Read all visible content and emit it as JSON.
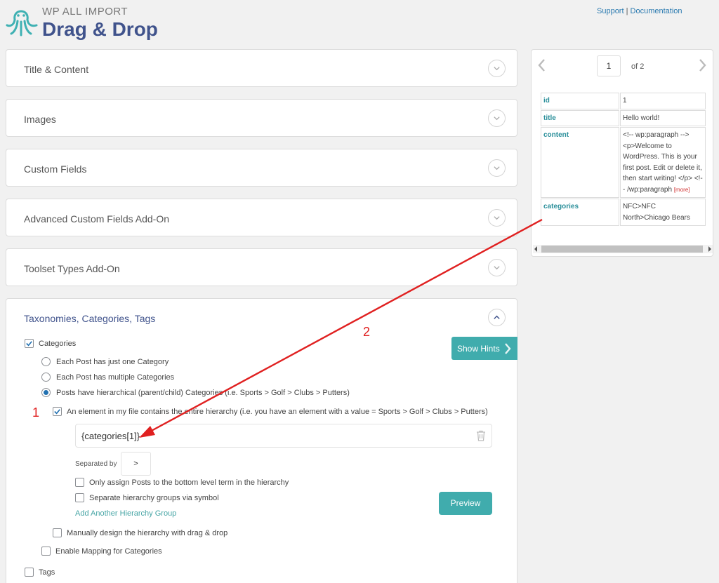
{
  "header": {
    "brand_small": "WP ALL IMPORT",
    "brand_big": "Drag & Drop",
    "support_link": "Support",
    "separator": "|",
    "docs_link": "Documentation"
  },
  "panels": [
    {
      "title": "Title & Content"
    },
    {
      "title": "Images"
    },
    {
      "title": "Custom Fields"
    },
    {
      "title": "Advanced Custom Fields Add-On"
    },
    {
      "title": "Toolset Types Add-On"
    }
  ],
  "taxonomies": {
    "title": "Taxonomies, Categories, Tags",
    "categories_label": "Categories",
    "radio_one": "Each Post has just one Category",
    "radio_multiple": "Each Post has multiple Categories",
    "radio_hierarchical": "Posts have hierarchical (parent/child) Categories (i.e. Sports > Golf > Clubs > Putters)",
    "element_hierarchy_label": "An element in my file contains the entire hierarchy (i.e. you have an element with a value = Sports > Golf > Clubs > Putters)",
    "hierarchy_value": "{categories[1]}",
    "separated_by_label": "Separated by",
    "separator_value": ">",
    "bottom_level_label": "Only assign Posts to the bottom level term in the hierarchy",
    "separate_groups_label": "Separate hierarchy groups via symbol",
    "add_group_link": "Add Another Hierarchy Group",
    "preview_button": "Preview",
    "manual_design_label": "Manually design the hierarchy with drag & drop",
    "enable_mapping_label": "Enable Mapping for Categories",
    "tags_label": "Tags"
  },
  "hints_button": "Show Hints",
  "annotations": {
    "step1": "1",
    "step2": "2"
  },
  "preview": {
    "page": "1",
    "of_label": "of 2",
    "rows": [
      {
        "key": "id",
        "value": "1"
      },
      {
        "key": "title",
        "value": "Hello world!"
      },
      {
        "key": "content",
        "value": "<!-- wp:paragraph --> <p>Welcome to WordPress. This is your first post. Edit or delete it, then start writing! </p> <!-- /wp:paragraph",
        "more": "[more]"
      },
      {
        "key": "categories",
        "value": "NFC>NFC North>Chicago Bears"
      }
    ]
  },
  "colors": {
    "accent_teal": "#40acad",
    "brand_blue": "#40538c",
    "annotation_red": "#e02020"
  },
  "icons": [
    "octopus-logo-icon",
    "chevron-down-icon",
    "chevron-up-icon",
    "trash-icon",
    "chevron-left-icon",
    "chevron-right-icon",
    "check-icon"
  ]
}
